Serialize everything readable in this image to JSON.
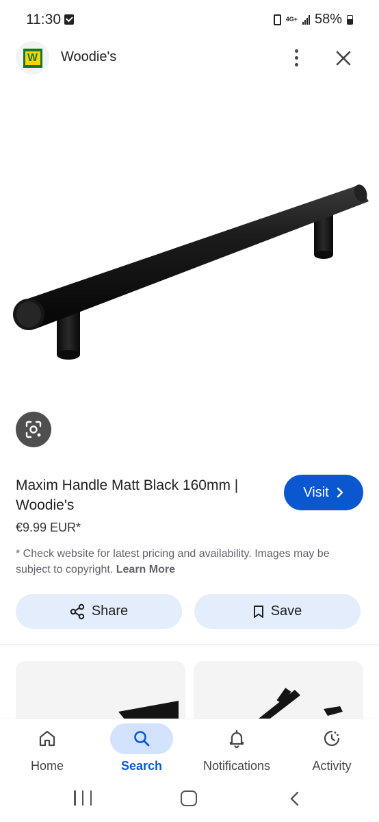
{
  "status_bar": {
    "time": "11:30",
    "network": "4G+",
    "battery": "58%"
  },
  "header": {
    "logo_letter": "W",
    "site_name": "Woodie's",
    "brand_colors": {
      "green": "#0f7a2e",
      "yellow": "#ffd200"
    }
  },
  "product": {
    "image_alt": "matt-black-bar-handle",
    "title": "Maxim Handle Matt Black 160mm | Woodie's",
    "price": "€9.99 EUR*",
    "disclaimer": "* Check website for latest pricing and availability. Images may be subject to copyright.",
    "learn_more": "Learn More"
  },
  "actions": {
    "visit": "Visit",
    "share": "Share",
    "save": "Save",
    "accent": "#0b57d0",
    "pill_bg": "#e3edfb"
  },
  "bottom_nav": {
    "items": [
      {
        "label": "Home",
        "icon": "home-icon"
      },
      {
        "label": "Search",
        "icon": "search-icon",
        "active": true
      },
      {
        "label": "Notifications",
        "icon": "bell-icon"
      },
      {
        "label": "Activity",
        "icon": "activity-icon"
      }
    ]
  },
  "system_nav": {
    "recents": "recents-icon",
    "home": "home-square-icon",
    "back": "back-icon"
  }
}
